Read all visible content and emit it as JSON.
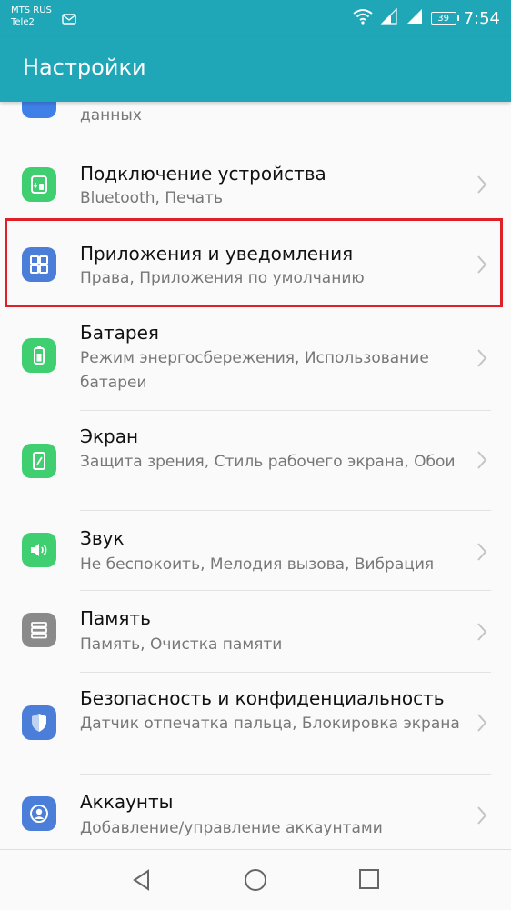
{
  "status_bar": {
    "carrier1": "MTS RUS",
    "carrier2": "Tele2",
    "battery": "39",
    "time": "7:54"
  },
  "app_bar": {
    "title": "Настройки"
  },
  "items": [
    {
      "title": "",
      "subtitle": "данных",
      "icon": "data-icon",
      "color": "#3f7fe8"
    },
    {
      "title": "Подключение устройства",
      "subtitle": "Bluetooth, Печать",
      "icon": "device-connection-icon",
      "color": "#3fcf70"
    },
    {
      "title": "Приложения и уведомления",
      "subtitle": "Права, Приложения по умолчанию",
      "icon": "apps-grid-icon",
      "color": "#4a7ed8"
    },
    {
      "title": "Батарея",
      "subtitle": "Режим энергосбережения, Использование батареи",
      "icon": "battery-icon",
      "color": "#3fcf70"
    },
    {
      "title": "Экран",
      "subtitle": "Защита зрения, Стиль рабочего экрана, Обои",
      "icon": "display-icon",
      "color": "#3fcf70"
    },
    {
      "title": "Звук",
      "subtitle": "Не беспокоить, Мелодия вызова, Вибрация",
      "icon": "speaker-icon",
      "color": "#3fcf70"
    },
    {
      "title": "Память",
      "subtitle": "Память, Очистка памяти",
      "icon": "storage-icon",
      "color": "#8a8a8a"
    },
    {
      "title": "Безопасность и конфиденциальность",
      "subtitle": "Датчик отпечатка пальца, Блокировка экрана",
      "icon": "shield-icon",
      "color": "#4a7ed8"
    },
    {
      "title": "Аккаунты",
      "subtitle": "Добавление/управление аккаунтами",
      "icon": "account-icon",
      "color": "#4a7ed8"
    }
  ],
  "nav_bar": [
    "back-icon",
    "home-icon",
    "recents-icon"
  ]
}
